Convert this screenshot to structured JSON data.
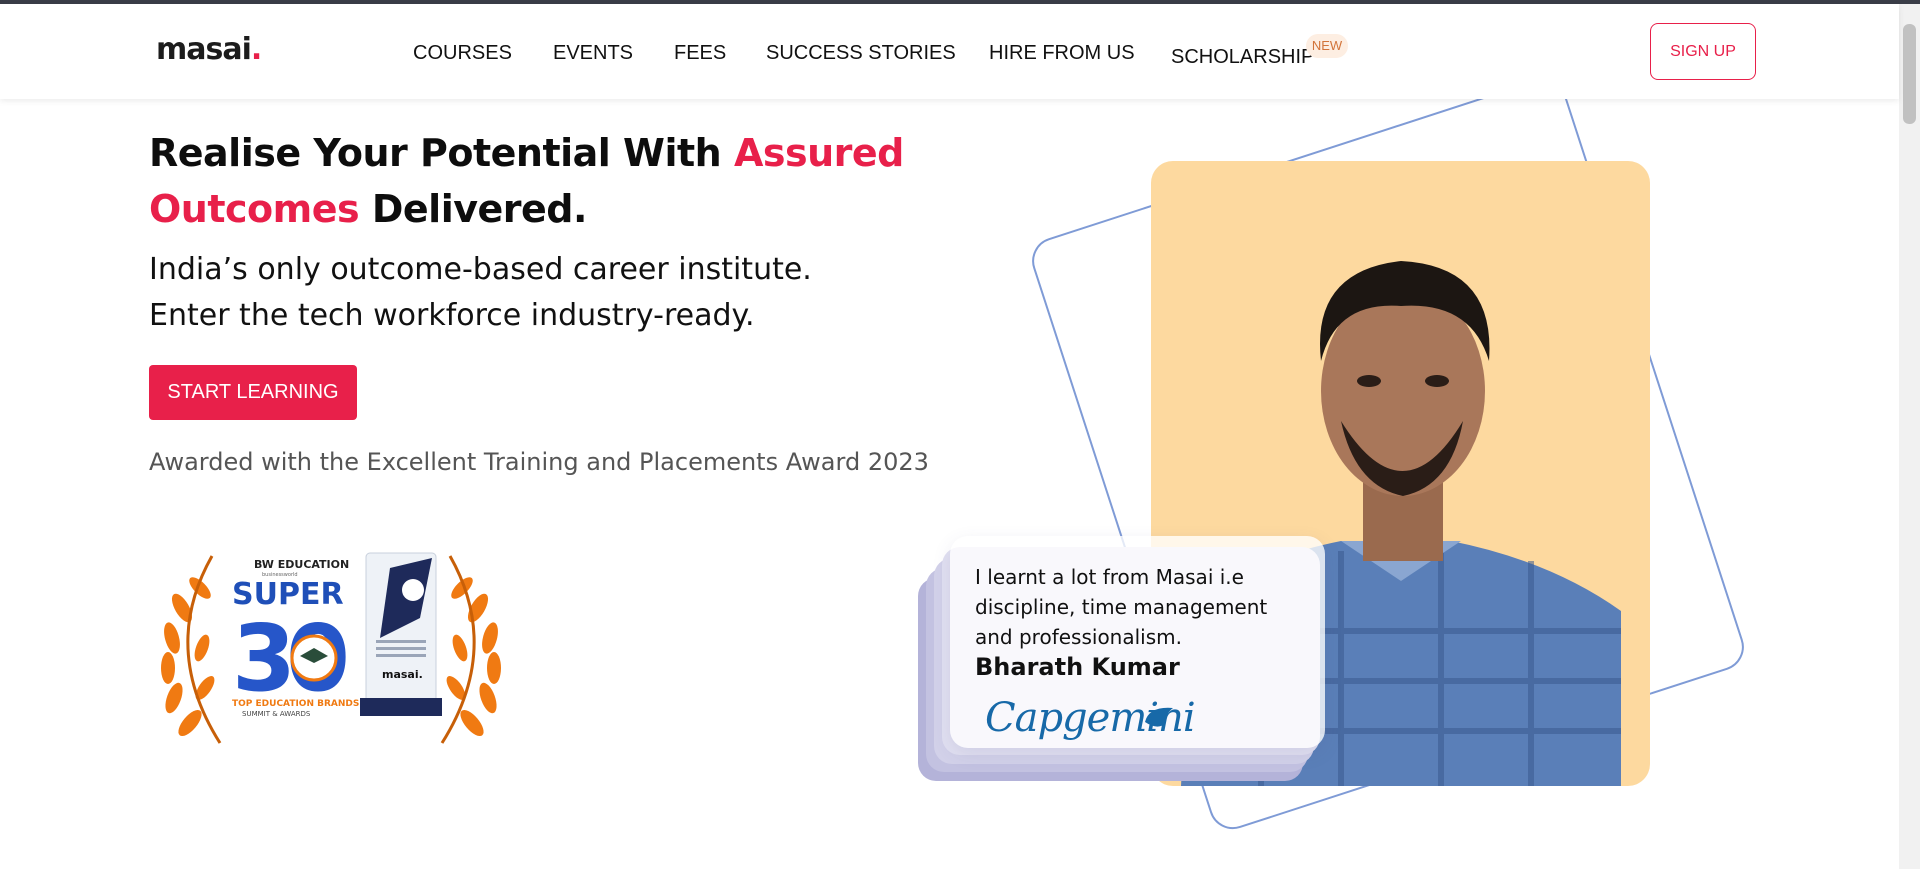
{
  "brand": {
    "logo_text": "masai",
    "logo_dot": ".",
    "accent_color": "#e8204a"
  },
  "nav": {
    "items": [
      {
        "label": "COURSES"
      },
      {
        "label": "EVENTS"
      },
      {
        "label": "FEES"
      },
      {
        "label": "SUCCESS STORIES"
      },
      {
        "label": "HIRE FROM US"
      },
      {
        "label": "SCHOLARSHIP",
        "badge": "NEW"
      }
    ],
    "signup_label": "SIGN UP"
  },
  "hero": {
    "headline_part1": "Realise Your Potential With ",
    "headline_accent1": "Assured",
    "headline_accent2": "Outcomes",
    "headline_part2": " Delivered.",
    "subline1": "India’s only outcome-based career institute.",
    "subline2": "Enter the tech workforce industry-ready.",
    "cta_label": "START LEARNING",
    "award_text": "Awarded with the Excellent Training and Placements Award 2023"
  },
  "award_badge": {
    "org": "BW EDUCATION",
    "tagline": "businessworld",
    "title": "SUPER",
    "number": "30",
    "subtitle": "TOP EDUCATION BRANDS",
    "footer": "SUMMIT & AWARDS",
    "trophy_brand": "masai."
  },
  "testimonial": {
    "quote": "I learnt a lot from Masai i.e discipline, time management and professionalism.",
    "name": "Bharath Kumar",
    "company": "Capgemini"
  }
}
